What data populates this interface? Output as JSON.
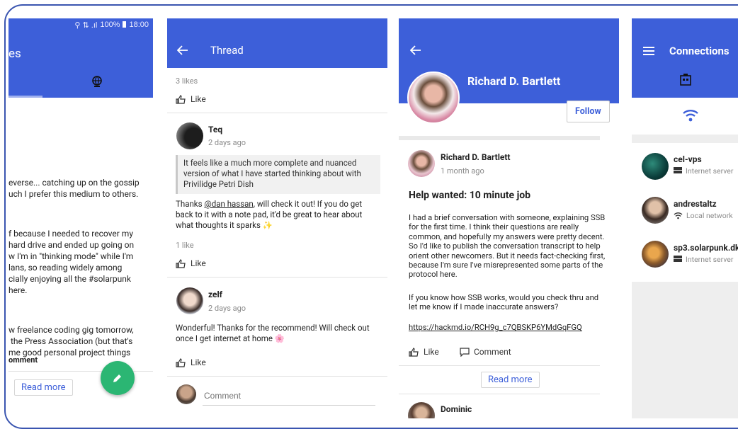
{
  "panel1": {
    "status": {
      "icons": "⚲ ⇅ .ıl",
      "battery": "100%",
      "time": "18:00"
    },
    "title_fragment": "es",
    "post_lines": [
      "everse... catching up on the gossip",
      "uch I prefer this medium to others.",
      "",
      "f because I needed to recover my",
      "hard drive and ended up going on",
      "w I'm in \"thinking mode\" while I'm",
      "lans, so reading widely among",
      "cially enjoying all the #solarpunk",
      "here.",
      "",
      "w freelance coding gig tomorrow,",
      " the Press Association (but that's",
      "me good personal project things"
    ],
    "comment_label": "omment",
    "read_more": "Read more"
  },
  "panel2": {
    "title": "Thread",
    "likes_top": "3 likes",
    "like_label": "Like",
    "comments": [
      {
        "author": "Teq",
        "time": "2 days ago",
        "quote": "It feels like a much more complete and nuanced version of what I have started thinking about with Privilidge Petri Dish",
        "text_prefix": "Thanks ",
        "mention": "@dan hassan",
        "text_suffix": ", will check it out! If you do get back to it with a note pad, it'd be great to hear about what thoughts it sparks ✨",
        "likes": "1 like"
      },
      {
        "author": "zelf",
        "time": "2 days ago",
        "text": "Wonderful! Thanks for the recommend! Will check out once I get internet at home 🌸"
      }
    ],
    "comment_placeholder": "Comment"
  },
  "panel3": {
    "profile_name": "Richard D. Bartlett",
    "follow_label": "Follow",
    "post": {
      "author": "Richard D. Bartlett",
      "time": "1 month ago",
      "title": "Help wanted: 10 minute job",
      "para1": "I had a brief conversation with someone, explaining SSB for the first time. I think their questions are really common, and hopefully my answers were pretty decent. So I'd like to publish the conversation transcript to help orient other newcomers. But it needs fact-checking first, because I'm sure I've misrepresented some parts of the protocol here.",
      "para2": "If you know how SSB works, would you check thru and let me know if I made inaccurate answers?",
      "link": "https://hackmd.io/RCH9g_c7QBSKP6YMdGqFGQ",
      "like_label": "Like",
      "comment_label": "Comment",
      "read_more": "Read more"
    },
    "next_author": "Dominic"
  },
  "panel4": {
    "title": "Connections",
    "items": [
      {
        "name": "cel-vps",
        "type": "Internet server"
      },
      {
        "name": "andrestaltz",
        "type": "Local network"
      },
      {
        "name": "sp3.solarpunk.dk",
        "type": "Internet server"
      }
    ]
  },
  "colors": {
    "accent": "#3d5fd9",
    "fab": "#2bb673",
    "frame": "#3a55b0"
  }
}
